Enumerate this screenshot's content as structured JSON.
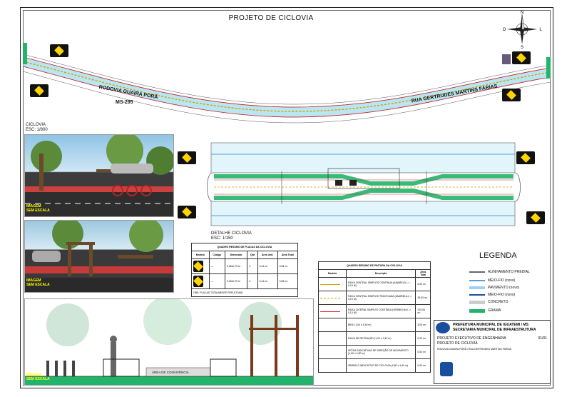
{
  "title": "PROJETO DE CICLOVIA",
  "compass": {
    "n": "N",
    "s": "S",
    "e": "L",
    "w": "O"
  },
  "roads": {
    "left": "RODOVIA GUAIRA PORÃ",
    "left_sub": "MS-295",
    "right": "RUA GERTRUDES MARTINS FARIAS"
  },
  "views": {
    "ciclovia": "CICLOVIA",
    "ciclovia_scale": "ESC: 1/800",
    "detalhe": "DETALHE CICLOVIA",
    "detalhe_scale": "ESC: 1/150"
  },
  "image_tag": {
    "line1": "IMAGEM",
    "line2": "SEM ESCALA"
  },
  "signs_table": {
    "title": "QUADRO RESUMO DE PLACAS DA CICLOVIA",
    "headers": [
      "Modelo",
      "Código",
      "Dimensão",
      "Qtd",
      "Área Unit.",
      "Área Total"
    ],
    "rows": [
      [
        "",
        "—",
        "0,45x0,75 m",
        "4",
        "0,21 m²",
        "0,84 m²"
      ],
      [
        "",
        "—",
        "0,45x0,75 m",
        "4",
        "0,21 m²",
        "0,84 m²"
      ]
    ],
    "footer": "OBS: PLACAS TOTALMENTE REFLETIVAS"
  },
  "paint_table": {
    "title": "QUADRO RESUMO DE PINTURA DA CICLOVIA",
    "headers": [
      "Modelo",
      "Descrição",
      "Área Total"
    ],
    "rows": [
      [
        "",
        "FAIXA CENTRAL SIMPLES CONTÍNUA (AMARELA L = 0,10 M)",
        "0,00 m²"
      ],
      [
        "",
        "FAIXA CENTRAL SIMPLES TRACEJADA (AMARELA L = 0,10 M)",
        "26,00 m²"
      ],
      [
        "",
        "FAIXA LATERAL SIMPLES CONTÍNUA (VERMELHA L = 0,10 M)",
        "120,00 m²"
      ],
      [
        "",
        "BIKE (1,00 x 1,50 m)",
        "3,00 m²"
      ],
      [
        "",
        "FAIXA DE RETENÇÃO (1,00 x 0,40 m)",
        "0,00 m²"
      ],
      [
        "",
        "SETAS INDICATIVAS DE DIREÇÃO DE MOVIMENTO (1,00 x 0,50 m)",
        "0,00 m²"
      ],
      [
        "",
        "SÍMBOLO INDICATIVO DE CICLOVIA (0,80 x 1,60 m)",
        "0,00 m²"
      ]
    ]
  },
  "legend": {
    "title": "LEGENDA",
    "items": [
      {
        "label": "ALINHAMENTO PREDIAL",
        "color": "#666666"
      },
      {
        "label": "MEIO-FIO (novo)",
        "color": "#5aa0d8"
      },
      {
        "label": "PAVIMENTO (novo)",
        "color": "#9fd0ef"
      },
      {
        "label": "MEIO-FIO (novo)",
        "color": "#1a4fa0"
      },
      {
        "label": "CONCRETO",
        "color": "#cccccc"
      },
      {
        "label": "GRAMA",
        "color": "#22b46a"
      }
    ]
  },
  "title_block": {
    "org1": "PREFEITURA MUNICIPAL DE IGUATEMI / MS",
    "org2": "SECRETARIA MUNICIPAL DE INFRAESTRUTURA",
    "project1": "PROJETO EXECUTIVO DE ENGENHARIA",
    "project2": "PROJETO DE CICLOVIA",
    "sheet": "01/01",
    "address": "RODOVIA GUAIRA PORÃ / RUA GERTRUDES MARTINS FARIAS"
  },
  "elevation_labels": {
    "area": "ÁREA DE CONVIVÊNCIA",
    "dims": [
      "1,06",
      "1,06",
      "1,05",
      "1,05",
      "1,06",
      "1,06"
    ],
    "codes": [
      "PC1",
      "PC2",
      "GD1",
      "GD1",
      "PC2",
      "CL01",
      "CD1"
    ]
  },
  "colors": {
    "road": "#b9e6f0",
    "grass": "#22b46a",
    "yellow": "#ffd400",
    "red": "#d6262b"
  }
}
